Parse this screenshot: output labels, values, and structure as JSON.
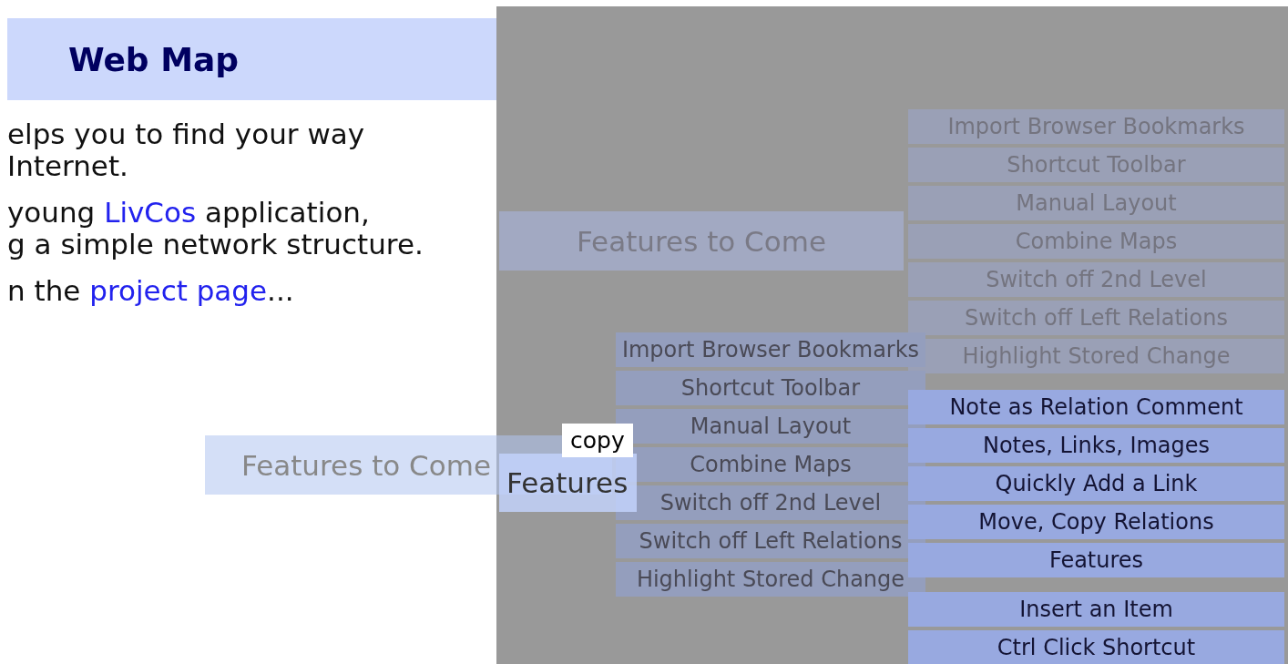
{
  "header": {
    "title": "Web Map"
  },
  "intro": [
    {
      "lines": [
        [
          {
            "text": "elps you to find your way",
            "link": false
          }
        ],
        [
          {
            "text": "Internet.",
            "link": false
          }
        ]
      ]
    },
    {
      "lines": [
        [
          {
            "text": "young ",
            "link": false
          },
          {
            "text": "LivCos",
            "link": true
          },
          {
            "text": " application,",
            "link": false
          }
        ],
        [
          {
            "text": "g a simple network structure.",
            "link": false
          }
        ]
      ]
    },
    {
      "lines": [
        [
          {
            "text": "n the ",
            "link": false
          },
          {
            "text": "project page",
            "link": true
          },
          {
            "text": "...",
            "link": false
          }
        ]
      ]
    }
  ],
  "map": {
    "faded_node": {
      "label": "Features to Come"
    },
    "faded_menu": [
      "Import Browser Bookmarks",
      "Shortcut Toolbar",
      "Manual Layout",
      "Combine Maps",
      "Switch off 2nd Level",
      "Switch off Left Relations",
      "Highlight Stored Change"
    ],
    "menu": [
      "Import Browser Bookmarks",
      "Shortcut Toolbar",
      "Manual Layout",
      "Combine Maps",
      "Switch off 2nd Level",
      "Switch off Left Relations",
      "Highlight Stored Change"
    ],
    "active_menu": [
      "Note as Relation Comment",
      "Notes, Links, Images",
      "Quickly Add a Link",
      "Move, Copy Relations",
      "Features"
    ],
    "bottom_menu": [
      "Insert an Item",
      "Ctrl Click Shortcut"
    ],
    "left_node": {
      "label": "Features to Come"
    },
    "center_node": {
      "label": "Features"
    },
    "copy_label": "copy"
  }
}
